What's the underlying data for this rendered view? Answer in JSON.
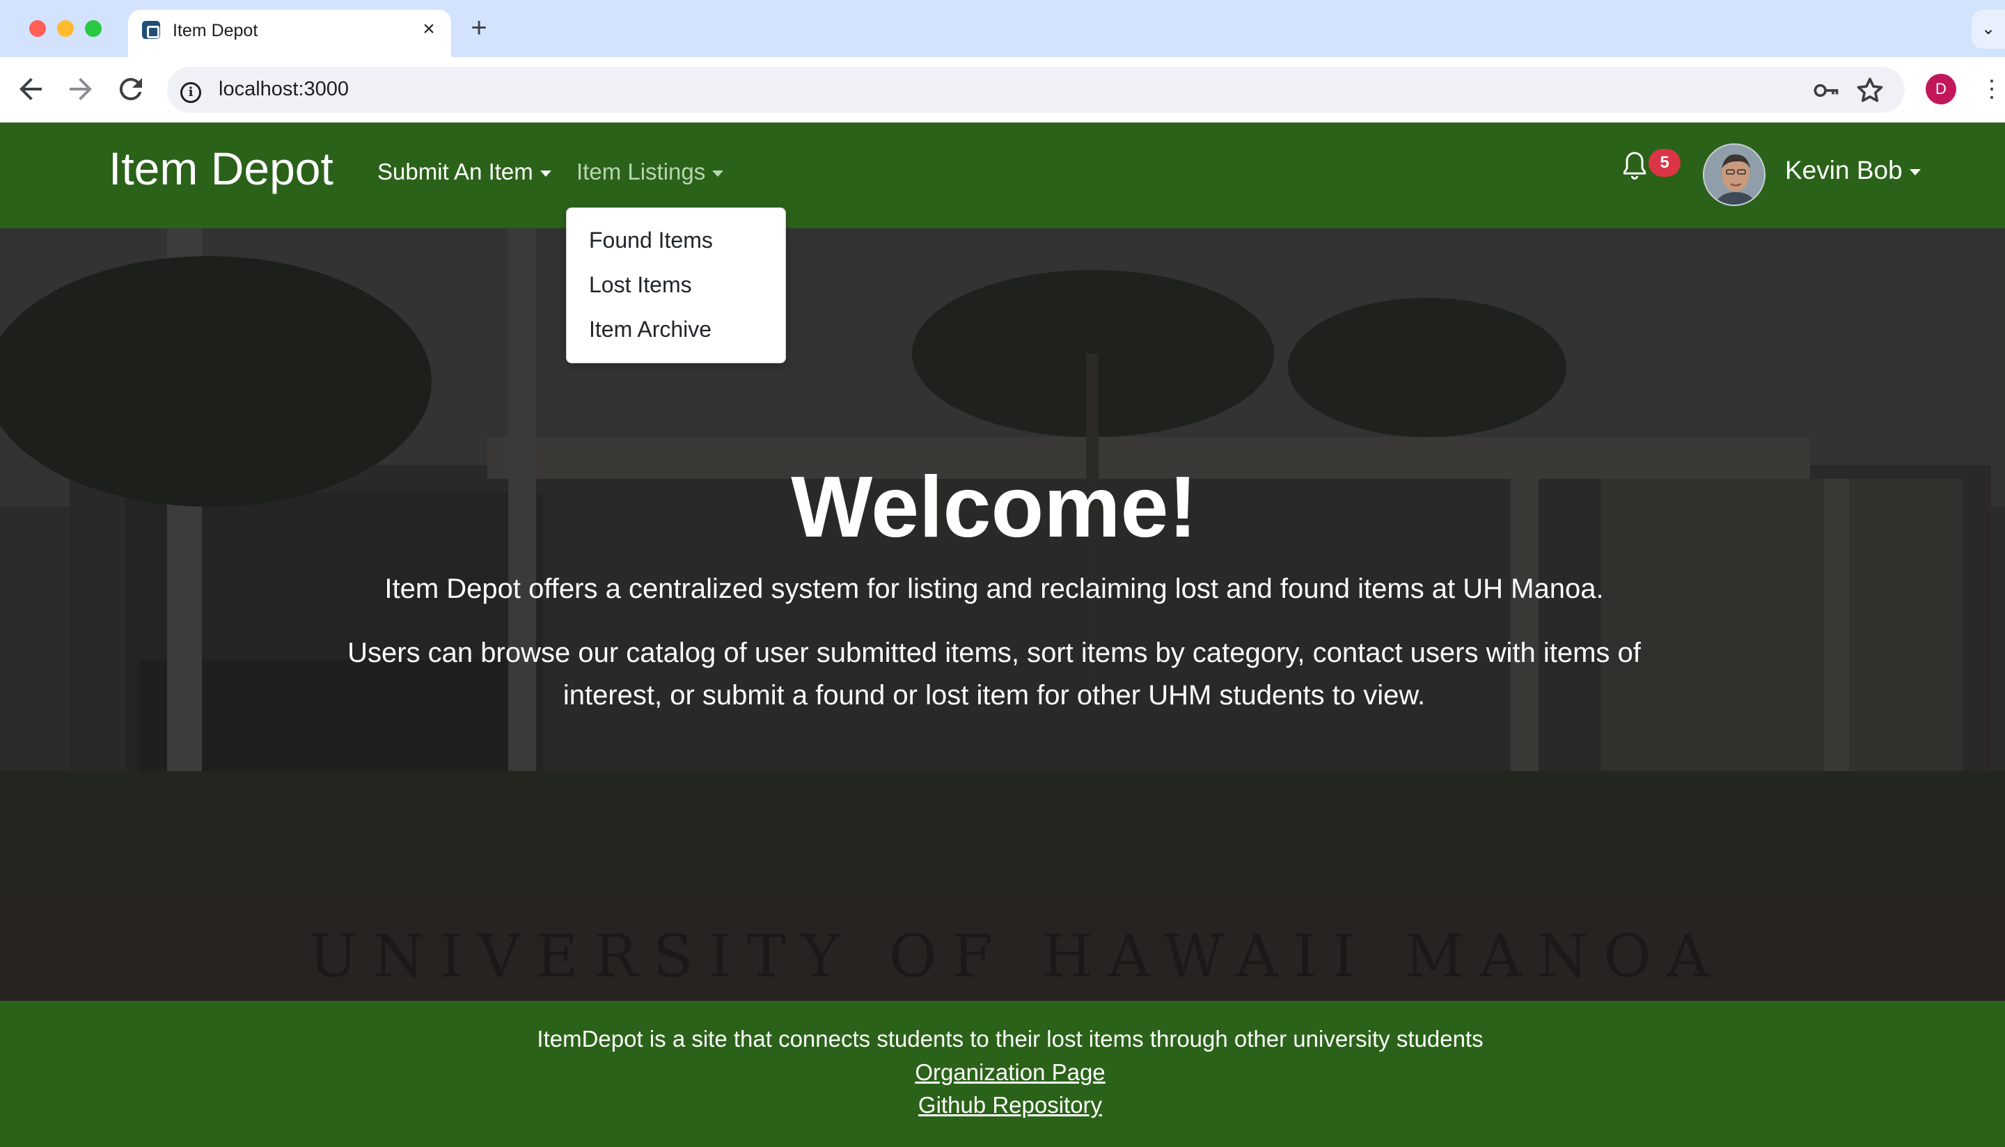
{
  "browser": {
    "tab_title": "Item Depot",
    "tab_close": "×",
    "new_tab": "+",
    "url": "localhost:3000",
    "profile_initial": "D"
  },
  "navbar": {
    "brand": "Item Depot",
    "submit_item": "Submit An Item",
    "item_listings": "Item Listings",
    "notification_count": "5",
    "user_name": "Kevin Bob"
  },
  "dropdown": {
    "items": [
      "Found Items",
      "Lost Items",
      "Item Archive"
    ]
  },
  "hero": {
    "title": "Welcome!",
    "paragraph1": "Item Depot offers a centralized system for listing and reclaiming lost and found items at UH Manoa.",
    "paragraph2": "Users can browse our catalog of user submitted items, sort items by category, contact users with items of interest, or submit a found or lost item for other UHM students to view.",
    "sign_text": "UNIVERSITY OF HAWAII MANOA"
  },
  "footer": {
    "text": "ItemDepot is a site that connects students to their lost items through other university students",
    "org_link": "Organization Page",
    "github_link": "Github Repository"
  },
  "colors": {
    "brand_green": "#2b6219",
    "badge_red": "#dc3545",
    "tab_bar": "#d3e3fd"
  }
}
